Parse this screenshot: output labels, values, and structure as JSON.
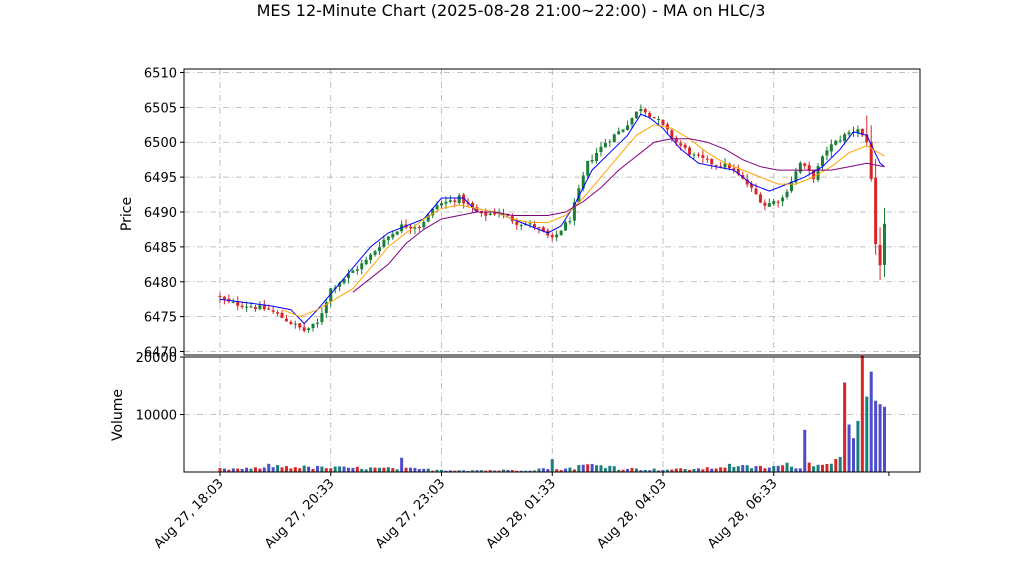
{
  "title": "MES 12-Minute Chart (2025-08-28 21:00~22:00) - MA on HLC/3",
  "chart_data": [
    {
      "type": "candlestick",
      "panel": "price",
      "ylabel": "Price",
      "ylim": [
        6469.5,
        6510.5
      ],
      "yticks": [
        6470,
        6475,
        6480,
        6485,
        6490,
        6495,
        6500,
        6505,
        6510
      ],
      "grid": true,
      "x_tick_labels": [
        "Aug 27, 18:03",
        "Aug 27, 20:33",
        "Aug 27, 23:03",
        "Aug 28, 01:33",
        "Aug 28, 04:03",
        "Aug 28, 06:33"
      ],
      "x_tick_bar_index": [
        0,
        25,
        50,
        75,
        100,
        125
      ],
      "bar_count": 151,
      "up_color": "#1a7f37",
      "down_color": "#d62728",
      "price_path": [
        [
          0,
          6478
        ],
        [
          3,
          6477
        ],
        [
          8,
          6476.5
        ],
        [
          12,
          6476
        ],
        [
          16,
          6474.5
        ],
        [
          20,
          6473
        ],
        [
          23,
          6474
        ],
        [
          26,
          6479
        ],
        [
          30,
          6481
        ],
        [
          34,
          6483
        ],
        [
          38,
          6486
        ],
        [
          42,
          6488
        ],
        [
          46,
          6488
        ],
        [
          50,
          6491
        ],
        [
          55,
          6492
        ],
        [
          60,
          6489.5
        ],
        [
          64,
          6490
        ],
        [
          68,
          6488.5
        ],
        [
          72,
          6488
        ],
        [
          76,
          6486
        ],
        [
          80,
          6489
        ],
        [
          84,
          6497
        ],
        [
          88,
          6500
        ],
        [
          92,
          6502
        ],
        [
          96,
          6505
        ],
        [
          100,
          6503
        ],
        [
          104,
          6500
        ],
        [
          108,
          6498
        ],
        [
          112,
          6497
        ],
        [
          116,
          6496.5
        ],
        [
          120,
          6494
        ],
        [
          124,
          6491
        ],
        [
          128,
          6492
        ],
        [
          132,
          6497
        ],
        [
          135,
          6495
        ],
        [
          138,
          6499
        ],
        [
          142,
          6501
        ],
        [
          145,
          6502
        ],
        [
          147,
          6500
        ],
        [
          148,
          6495
        ],
        [
          149,
          6485
        ],
        [
          150,
          6482
        ],
        [
          151,
          6488
        ]
      ],
      "series": [
        {
          "color": "#0000ff",
          "points": [
            [
              0,
              6477.5
            ],
            [
              6,
              6477
            ],
            [
              12,
              6476.5
            ],
            [
              16,
              6476
            ],
            [
              19,
              6474
            ],
            [
              22,
              6476
            ],
            [
              26,
              6479
            ],
            [
              30,
              6482
            ],
            [
              34,
              6485
            ],
            [
              38,
              6487
            ],
            [
              42,
              6488
            ],
            [
              46,
              6489
            ],
            [
              50,
              6492
            ],
            [
              55,
              6492
            ],
            [
              58,
              6490
            ],
            [
              62,
              6490
            ],
            [
              66,
              6489
            ],
            [
              70,
              6488
            ],
            [
              74,
              6487
            ],
            [
              77,
              6488
            ],
            [
              80,
              6491
            ],
            [
              84,
              6496
            ],
            [
              88,
              6498.5
            ],
            [
              92,
              6501
            ],
            [
              95,
              6504
            ],
            [
              97,
              6503.5
            ],
            [
              100,
              6502
            ],
            [
              104,
              6499
            ],
            [
              108,
              6497
            ],
            [
              112,
              6496.5
            ],
            [
              116,
              6496
            ],
            [
              120,
              6494
            ],
            [
              124,
              6493
            ],
            [
              128,
              6494
            ],
            [
              132,
              6495
            ],
            [
              136,
              6496.5
            ],
            [
              140,
              6499
            ],
            [
              143,
              6501.5
            ],
            [
              146,
              6501
            ],
            [
              149,
              6497
            ],
            [
              150,
              6496.5
            ]
          ]
        },
        {
          "color": "#ffa500",
          "points": [
            [
              14,
              6476
            ],
            [
              18,
              6475
            ],
            [
              22,
              6476
            ],
            [
              26,
              6477.5
            ],
            [
              30,
              6479
            ],
            [
              34,
              6482
            ],
            [
              38,
              6485
            ],
            [
              42,
              6487
            ],
            [
              46,
              6489
            ],
            [
              50,
              6490.5
            ],
            [
              54,
              6491
            ],
            [
              58,
              6490.5
            ],
            [
              62,
              6490
            ],
            [
              66,
              6489
            ],
            [
              70,
              6488.5
            ],
            [
              74,
              6488.5
            ],
            [
              78,
              6489.5
            ],
            [
              82,
              6492
            ],
            [
              86,
              6495
            ],
            [
              90,
              6498
            ],
            [
              94,
              6501
            ],
            [
              98,
              6502.5
            ],
            [
              102,
              6502
            ],
            [
              106,
              6500.5
            ],
            [
              110,
              6498.5
            ],
            [
              114,
              6497
            ],
            [
              118,
              6496
            ],
            [
              122,
              6495
            ],
            [
              126,
              6494
            ],
            [
              130,
              6494
            ],
            [
              134,
              6495
            ],
            [
              138,
              6496.5
            ],
            [
              142,
              6498.5
            ],
            [
              146,
              6499.5
            ],
            [
              150,
              6498
            ]
          ]
        },
        {
          "color": "#800080",
          "points": [
            [
              30,
              6478.5
            ],
            [
              34,
              6480.5
            ],
            [
              38,
              6482.5
            ],
            [
              42,
              6485.5
            ],
            [
              46,
              6487.5
            ],
            [
              50,
              6489
            ],
            [
              54,
              6489.5
            ],
            [
              58,
              6490
            ],
            [
              62,
              6490
            ],
            [
              66,
              6489.5
            ],
            [
              70,
              6489.5
            ],
            [
              74,
              6489.5
            ],
            [
              78,
              6490
            ],
            [
              82,
              6491.5
            ],
            [
              86,
              6493.5
            ],
            [
              90,
              6496
            ],
            [
              94,
              6498
            ],
            [
              98,
              6500
            ],
            [
              102,
              6500.5
            ],
            [
              106,
              6500.5
            ],
            [
              110,
              6500
            ],
            [
              114,
              6499
            ],
            [
              118,
              6497.5
            ],
            [
              122,
              6496.5
            ],
            [
              126,
              6496
            ],
            [
              130,
              6496
            ],
            [
              134,
              6496
            ],
            [
              138,
              6496
            ],
            [
              142,
              6496.5
            ],
            [
              146,
              6497
            ],
            [
              150,
              6496.5
            ]
          ]
        }
      ]
    },
    {
      "type": "bar",
      "panel": "volume",
      "ylabel": "Volume",
      "ylim": [
        0,
        20000
      ],
      "yticks": [
        10000,
        20000
      ],
      "grid": true,
      "bar_colors": [
        "#1a7f7a",
        "#d62728",
        "#4d4dcc"
      ],
      "volume_profile": [
        [
          0,
          500
        ],
        [
          9,
          600
        ],
        [
          10,
          1100
        ],
        [
          20,
          800
        ],
        [
          40,
          600
        ],
        [
          41,
          1800
        ],
        [
          42,
          600
        ],
        [
          50,
          350
        ],
        [
          60,
          300
        ],
        [
          70,
          350
        ],
        [
          74,
          700
        ],
        [
          75,
          1700
        ],
        [
          76,
          500
        ],
        [
          80,
          700
        ],
        [
          82,
          1200
        ],
        [
          88,
          1100
        ],
        [
          90,
          600
        ],
        [
          100,
          400
        ],
        [
          110,
          600
        ],
        [
          116,
          1200
        ],
        [
          118,
          900
        ],
        [
          124,
          800
        ],
        [
          128,
          1200
        ],
        [
          131,
          900
        ],
        [
          132,
          6500
        ],
        [
          133,
          1500
        ],
        [
          136,
          1800
        ],
        [
          138,
          1200
        ],
        [
          139,
          2000
        ],
        [
          140,
          3500
        ],
        [
          141,
          19000
        ],
        [
          142,
          12500
        ],
        [
          143,
          7500
        ],
        [
          144,
          14500
        ],
        [
          145,
          15500
        ],
        [
          146,
          14000
        ],
        [
          147,
          12500
        ],
        [
          148,
          9000
        ],
        [
          149,
          11000
        ],
        [
          150,
          9500
        ]
      ]
    }
  ]
}
